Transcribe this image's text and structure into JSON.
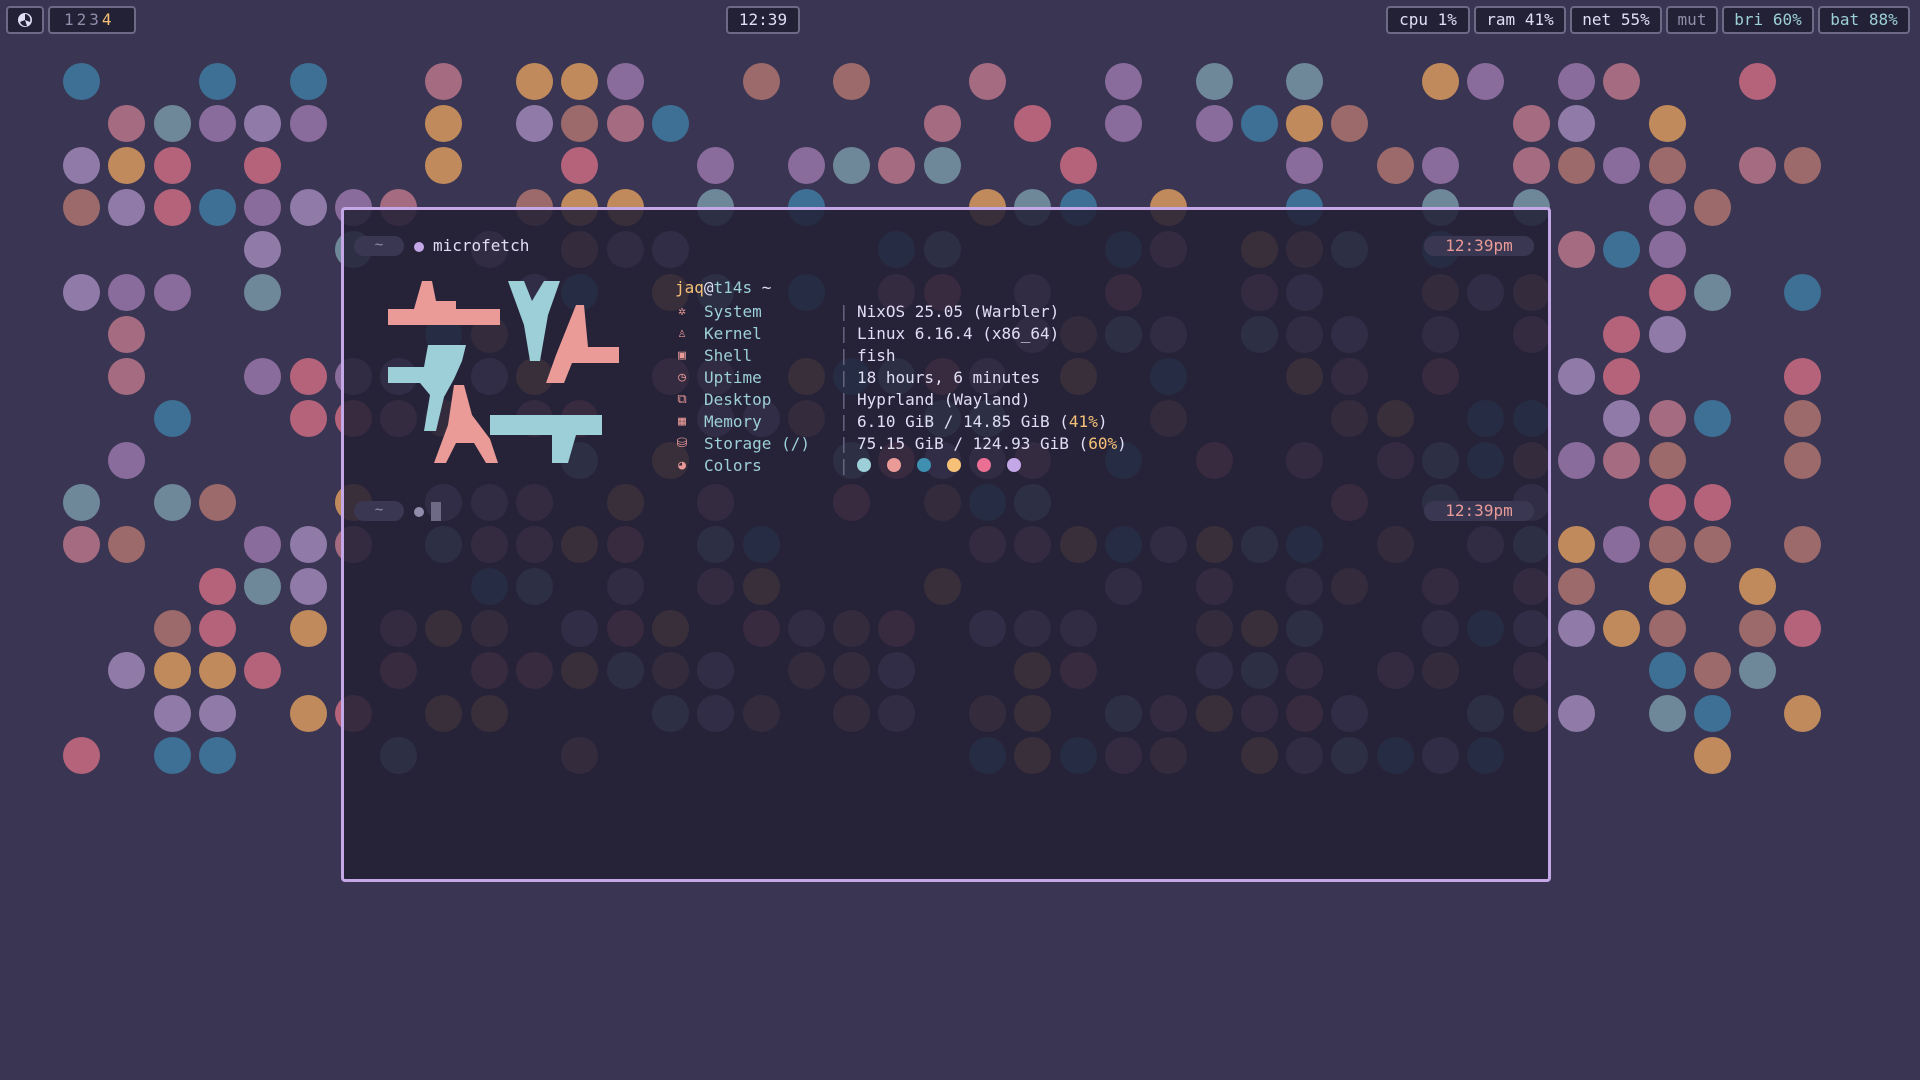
{
  "palette": {
    "background": "#393552",
    "love": "#eb6f92",
    "rose": "#ea9a97",
    "gold": "#f6c177",
    "pine": "#3e8fb0",
    "foam": "#9ccfd8",
    "iris": "#c4a7e7",
    "muted": "#6e6a86",
    "subtle": "#908caa",
    "text": "#e0def4"
  },
  "topbar": {
    "logo_icon": "nixos-snowflake-icon",
    "workspaces": [
      "1",
      "2",
      "3",
      "4"
    ],
    "active_workspace": "4",
    "clock": "12:39",
    "stats": [
      {
        "label": "cpu 1%",
        "style": "normal"
      },
      {
        "label": "ram 41%",
        "style": "normal"
      },
      {
        "label": "net 55%",
        "style": "normal"
      },
      {
        "label": "mut",
        "style": "muted"
      },
      {
        "label": "bri 60%",
        "style": "accent"
      },
      {
        "label": "bat 88%",
        "style": "accent"
      }
    ]
  },
  "terminal": {
    "prompt_dir": "~",
    "command": "microfetch",
    "prompt_time": "12:39pm",
    "second_prompt_time": "12:39pm",
    "user": "jaq",
    "at": "@",
    "host": "t14s",
    "cwd": " ~",
    "info": [
      {
        "icon": "nixos-icon",
        "label": "System",
        "value": "NixOS 25.05 (Warbler)"
      },
      {
        "icon": "linux-icon",
        "label": "Kernel",
        "value": "Linux 6.16.4 (x86_64)"
      },
      {
        "icon": "terminal-icon",
        "label": "Shell",
        "value": "fish"
      },
      {
        "icon": "clock-icon",
        "label": "Uptime",
        "value": "18 hours, 6 minutes"
      },
      {
        "icon": "desktop-icon",
        "label": "Desktop",
        "value": "Hyprland (Wayland)"
      },
      {
        "icon": "cpu-chip-icon",
        "label": "Memory",
        "value_main": "6.10 GiB / 14.85 GiB (",
        "value_pct": "41%",
        "value_end": ")"
      },
      {
        "icon": "database-icon",
        "label": "Storage (/)",
        "value_main": "75.15 GiB / 124.93 GiB (",
        "value_pct": "60%",
        "value_end": ")"
      },
      {
        "icon": "palette-icon",
        "label": "Colors",
        "swatches": [
          "#9ccfd8",
          "#ea9a97",
          "#3e8fb0",
          "#f6c177",
          "#eb6f92",
          "#c4a7e7"
        ]
      }
    ]
  }
}
